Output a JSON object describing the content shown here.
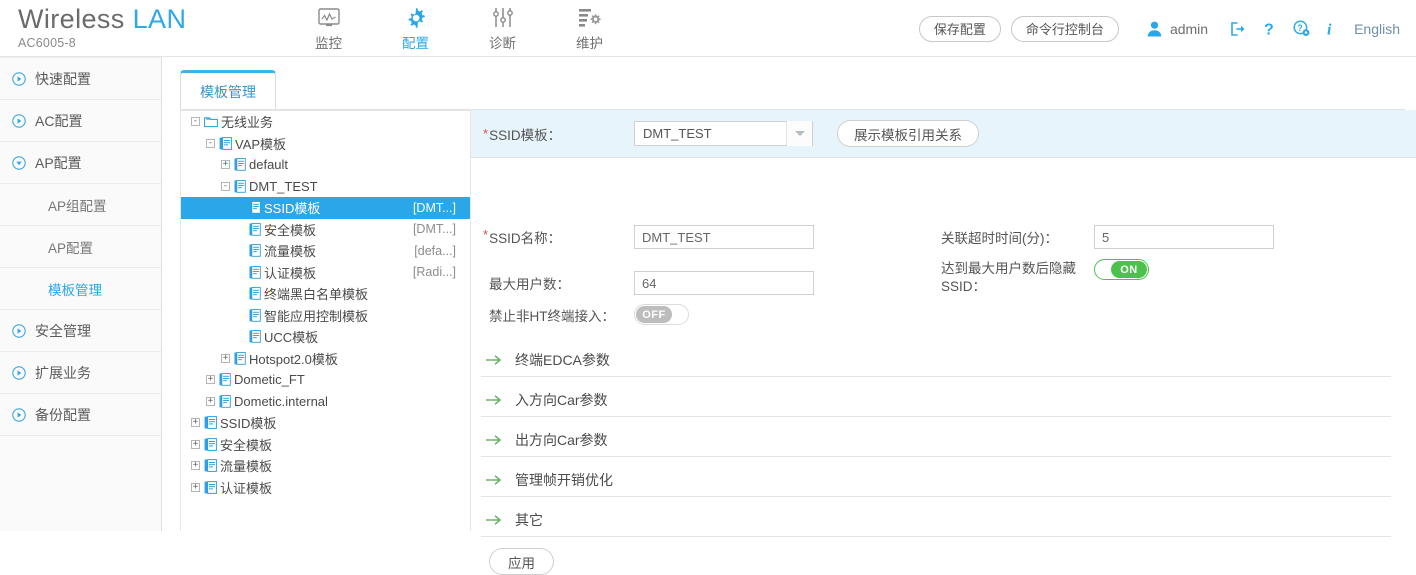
{
  "header": {
    "brand_main": "Wireless",
    "brand_accent": "LAN",
    "model": "AC6005-8",
    "nav": [
      {
        "label": "监控",
        "icon": "monitor-icon",
        "active": false
      },
      {
        "label": "配置",
        "icon": "gear-icon",
        "active": true
      },
      {
        "label": "诊断",
        "icon": "sliders-icon",
        "active": false
      },
      {
        "label": "维护",
        "icon": "maintenance-icon",
        "active": false
      }
    ],
    "save_config": "保存配置",
    "cli_console": "命令行控制台",
    "user": "admin",
    "language": "English",
    "icons": [
      "logout-icon",
      "help-icon",
      "help-settings-icon",
      "info-icon"
    ],
    "accent": "#29a7e8"
  },
  "sidebar": {
    "items": [
      {
        "label": "快速配置",
        "type": "group",
        "expanded": false,
        "active": false
      },
      {
        "label": "AC配置",
        "type": "group",
        "expanded": false,
        "active": false
      },
      {
        "label": "AP配置",
        "type": "group",
        "expanded": true,
        "active": false
      },
      {
        "label": "AP组配置",
        "type": "sub",
        "active": false
      },
      {
        "label": "AP配置",
        "type": "sub",
        "active": false
      },
      {
        "label": "模板管理",
        "type": "sub",
        "active": true
      },
      {
        "label": "安全管理",
        "type": "group",
        "expanded": false,
        "active": false
      },
      {
        "label": "扩展业务",
        "type": "group",
        "expanded": false,
        "active": false
      },
      {
        "label": "备份配置",
        "type": "group",
        "expanded": false,
        "active": false
      }
    ]
  },
  "tabs": [
    {
      "label": "模板管理",
      "active": true
    }
  ],
  "tree": [
    {
      "indent": 0,
      "toggle": "-",
      "icon": "folder-icon",
      "label": "无线业务",
      "value": "",
      "selected": false
    },
    {
      "indent": 1,
      "toggle": "-",
      "icon": "template-folder-icon",
      "label": "VAP模板",
      "value": "",
      "selected": false
    },
    {
      "indent": 2,
      "toggle": "+",
      "icon": "template-icon",
      "label": "default",
      "value": "",
      "selected": false
    },
    {
      "indent": 2,
      "toggle": "-",
      "icon": "template-icon",
      "label": "DMT_TEST",
      "value": "",
      "selected": false
    },
    {
      "indent": 3,
      "toggle": "",
      "icon": "template-icon",
      "label": "SSID模板",
      "value": "[DMT...]",
      "selected": true
    },
    {
      "indent": 3,
      "toggle": "",
      "icon": "template-icon",
      "label": "安全模板",
      "value": "[DMT...]",
      "selected": false
    },
    {
      "indent": 3,
      "toggle": "",
      "icon": "template-icon",
      "label": "流量模板",
      "value": "[defa...]",
      "selected": false
    },
    {
      "indent": 3,
      "toggle": "",
      "icon": "template-icon",
      "label": "认证模板",
      "value": "[Radi...]",
      "selected": false
    },
    {
      "indent": 3,
      "toggle": "",
      "icon": "template-icon",
      "label": "终端黑白名单模板",
      "value": "",
      "selected": false
    },
    {
      "indent": 3,
      "toggle": "",
      "icon": "template-icon",
      "label": "智能应用控制模板",
      "value": "",
      "selected": false
    },
    {
      "indent": 3,
      "toggle": "",
      "icon": "template-icon",
      "label": "UCC模板",
      "value": "",
      "selected": false
    },
    {
      "indent": 2,
      "toggle": "+",
      "icon": "template-icon",
      "label": "Hotspot2.0模板",
      "value": "",
      "selected": false
    },
    {
      "indent": 1,
      "toggle": "+",
      "icon": "template-icon",
      "label": "Dometic_FT",
      "value": "",
      "selected": false
    },
    {
      "indent": 1,
      "toggle": "+",
      "icon": "template-icon",
      "label": "Dometic.internal",
      "value": "",
      "selected": false
    },
    {
      "indent": 0,
      "toggle": "+",
      "icon": "template-folder-icon",
      "label": "SSID模板",
      "value": "",
      "selected": false
    },
    {
      "indent": 0,
      "toggle": "+",
      "icon": "template-folder-icon",
      "label": "安全模板",
      "value": "",
      "selected": false
    },
    {
      "indent": 0,
      "toggle": "+",
      "icon": "template-folder-icon",
      "label": "流量模板",
      "value": "",
      "selected": false
    },
    {
      "indent": 0,
      "toggle": "+",
      "icon": "template-folder-icon",
      "label": "认证模板",
      "value": "",
      "selected": false
    }
  ],
  "form": {
    "template_label": "SSID模板：",
    "template_value": "DMT_TEST",
    "show_relation_btn": "展示模板引用关系",
    "ssid_name_label": "SSID名称：",
    "ssid_name_value": "DMT_TEST",
    "max_users_label": "最大用户数：",
    "max_users_value": "64",
    "disable_nonht_label": "禁止非HT终端接入：",
    "disable_nonht_state": "OFF",
    "assoc_timeout_label": "关联超时时间(分)：",
    "assoc_timeout_value": "5",
    "hide_ssid_label": "达到最大用户数后隐藏SSID：",
    "hide_ssid_state": "ON",
    "sections": [
      {
        "label": "终端EDCA参数"
      },
      {
        "label": "入方向Car参数"
      },
      {
        "label": "出方向Car参数"
      },
      {
        "label": "管理帧开销优化"
      },
      {
        "label": "其它"
      }
    ],
    "apply_label": "应用"
  }
}
